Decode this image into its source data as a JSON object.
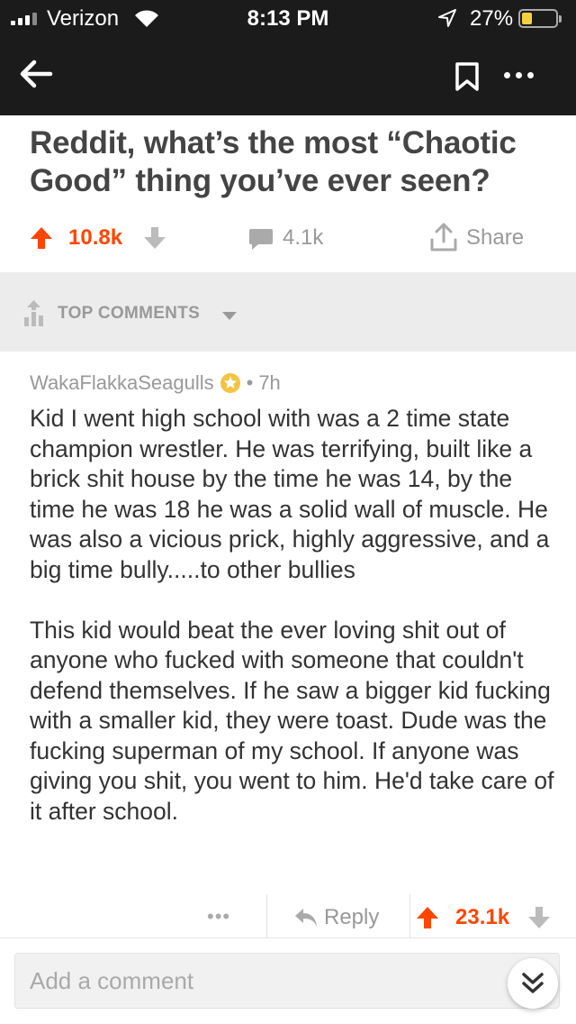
{
  "status_bar": {
    "carrier": "Verizon",
    "time": "8:13 PM",
    "battery": "27%",
    "battery_level": 0.27
  },
  "nav": {
    "back_icon": "arrow-left-icon",
    "bookmark_icon": "bookmark-icon",
    "more_icon": "more-dots-icon"
  },
  "post": {
    "title": "Reddit, what’s the most “Chaotic Good” thing you’ve ever seen?",
    "votes": "10.8k",
    "comments": "4.1k",
    "share_label": "Share"
  },
  "sort": {
    "label": "TOP COMMENTS"
  },
  "comment": {
    "author": "WakaFlakkaSeagulls",
    "separator": "•",
    "age": "7h",
    "paragraphs": [
      "Kid I went high school with was a 2 time state champion wrestler. He was terrifying, built like a brick shit house by the time he was 14, by the time he was 18 he was a solid wall of muscle. He was also a vicious prick, highly aggressive, and a big time bully.....to other bullies",
      "This kid would beat the ever loving shit out of anyone who fucked with someone that couldn't defend themselves. If he saw a bigger kid fucking with a smaller kid, they were toast. Dude was the fucking superman of my school. If anyone was giving you shit, you went to him. He'd take care of it after school."
    ],
    "more_label": "•••",
    "reply_label": "Reply",
    "votes": "23.1k"
  },
  "composer": {
    "placeholder": "Add a comment"
  },
  "colors": {
    "accent": "#ff4500",
    "header_bg": "#1b1b1b",
    "muted": "#999999",
    "sort_bg": "#ececec"
  }
}
